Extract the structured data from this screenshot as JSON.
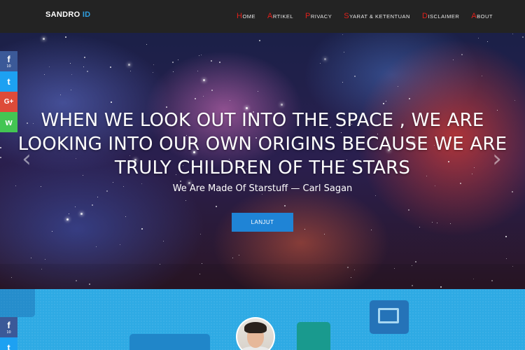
{
  "navbar": {
    "brand_main": "SANDRO ",
    "brand_accent": "ID",
    "items": [
      {
        "first": "H",
        "rest": "ome"
      },
      {
        "first": "A",
        "rest": "rtikel"
      },
      {
        "first": "P",
        "rest": "rivacy"
      },
      {
        "first": "S",
        "rest": "yarat & ketentuan"
      },
      {
        "first": "D",
        "rest": "isclaimer"
      },
      {
        "first": "A",
        "rest": "bout"
      }
    ]
  },
  "hero": {
    "title": "WHEN WE LOOK OUT INTO THE SPACE , WE ARE LOOKING INTO OUR OWN ORIGINS BECAUSE WE ARE TRULY CHILDREN OF THE STARS",
    "subtitle": "We Are Made Of Starstuff — Carl Sagan",
    "button_label": "LANJUT",
    "prev_arrow": "‹",
    "next_arrow": "›"
  },
  "share_bar": {
    "facebook_icon": "f",
    "facebook_count": "10",
    "twitter_icon": "t",
    "googleplus_icon": "G+",
    "whatsapp_icon": "w"
  },
  "share_bar_lower": {
    "facebook_icon": "f",
    "facebook_count": "10",
    "twitter_icon": "t"
  },
  "colors": {
    "nav_bg": "#232323",
    "accent_red": "#e0201b",
    "brand_blue": "#2f9fe0",
    "button_blue": "#1f84d6",
    "lower_bg": "#2eaae4",
    "facebook": "#3b5998",
    "twitter": "#1da1f2",
    "googleplus": "#dd4b39",
    "whatsapp": "#43c553"
  }
}
